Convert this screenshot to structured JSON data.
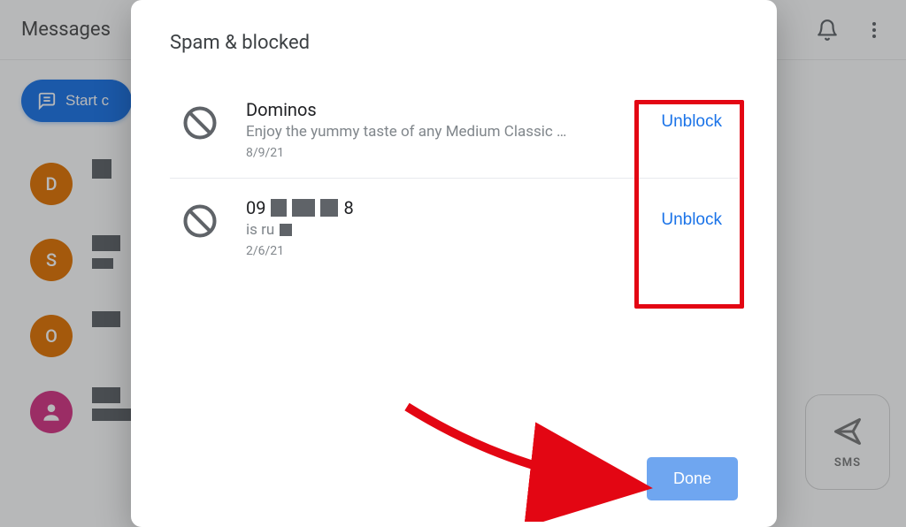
{
  "app": {
    "title": "Messages",
    "start_chat_label": "Start c",
    "sms_label": "SMS",
    "bell_icon": "bell-icon",
    "more_icon": "more-vert-icon",
    "list": [
      {
        "initial": "D",
        "color": "#e37400"
      },
      {
        "initial": "S",
        "color": "#e37400"
      },
      {
        "initial": "O",
        "color": "#e37400"
      },
      {
        "initial": "",
        "color": "#d63384",
        "is_person": true
      }
    ]
  },
  "dialog": {
    "title": "Spam & blocked",
    "rows": [
      {
        "sender": "Dominos",
        "preview": "Enjoy the yummy taste of any Medium Classic …",
        "date": "8/9/21",
        "action_label": "Unblock"
      },
      {
        "sender_prefix": "09",
        "sender_suffix": "8",
        "preview_prefix": "is ru",
        "date": "2/6/21",
        "action_label": "Unblock",
        "redacted": true
      }
    ],
    "done_label": "Done"
  },
  "annotations": {
    "highlight": "unblock-column",
    "arrow_target": "done-button"
  }
}
